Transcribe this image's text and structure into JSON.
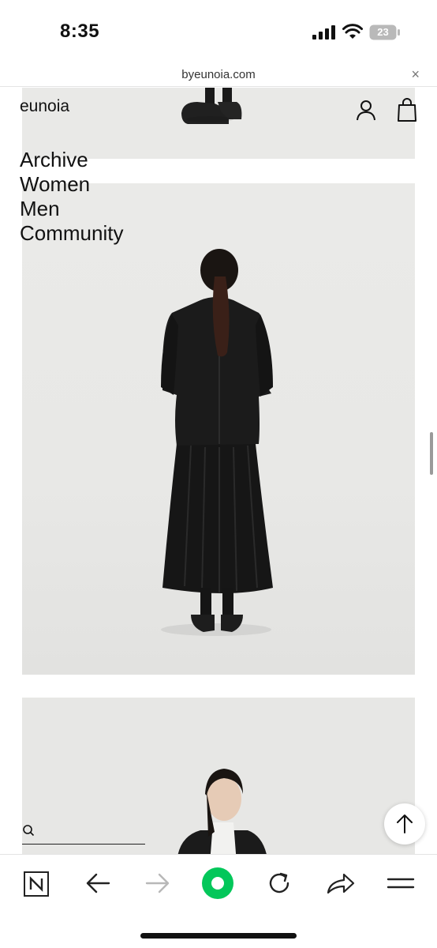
{
  "status_bar": {
    "time": "8:35",
    "battery": "23"
  },
  "browser": {
    "url": "byeunoia.com",
    "close_symbol": "×"
  },
  "site": {
    "brand": "eunoia",
    "nav": [
      "Archive",
      "Women",
      "Men",
      "Community"
    ]
  },
  "colors": {
    "home_button": "#03c75a",
    "text": "#111111",
    "photo_bg": "#e9e9e7"
  },
  "icons": {
    "account": "account-icon",
    "cart": "cart-icon",
    "search": "search-icon",
    "scroll_top": "arrow-up-icon",
    "toolbar": [
      "n-icon",
      "back-icon",
      "forward-icon",
      "home-icon",
      "reload-icon",
      "share-icon",
      "menu-icon"
    ]
  }
}
